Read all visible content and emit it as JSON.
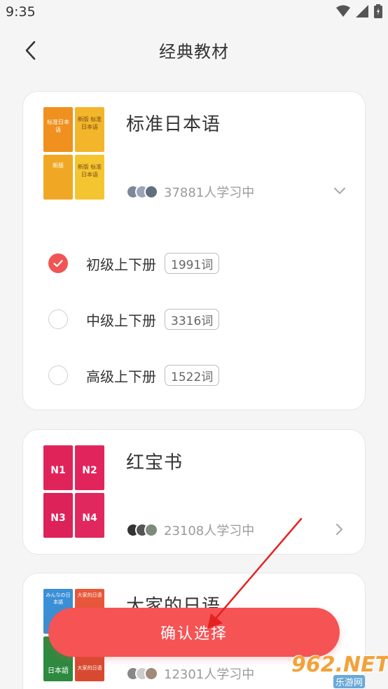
{
  "status_bar": {
    "time": "9:35"
  },
  "header": {
    "title": "经典教材"
  },
  "books": [
    {
      "title": "标准日本语",
      "learners": "37881人学习中",
      "cover_texts": [
        "标准日本语",
        "新版 标准日本语",
        "新版",
        "新版 标准日本语"
      ],
      "levels": [
        {
          "label": "初级上下册",
          "words": "1991词",
          "selected": true
        },
        {
          "label": "中级上下册",
          "words": "3316词",
          "selected": false
        },
        {
          "label": "高级上下册",
          "words": "1522词",
          "selected": false
        }
      ]
    },
    {
      "title": "红宝书",
      "learners": "23108人学习中",
      "cover_texts": [
        "N1",
        "N2",
        "N3",
        "N4"
      ]
    },
    {
      "title": "大家的日语",
      "learners": "12301人学习中",
      "cover_texts": [
        "みんなの日本語",
        "大家的日语",
        "日本語",
        "大家的日语"
      ]
    }
  ],
  "confirm_button": {
    "label": "确认选择"
  },
  "watermark": {
    "main": "962.NET",
    "sub": "乐游网"
  },
  "colors": {
    "accent": "#f55354",
    "check": "#f05454",
    "muted": "#9a9a9a"
  },
  "icons": [
    "wifi-icon",
    "signal-icon",
    "battery-icon",
    "back-arrow-icon",
    "chevron-down-icon",
    "chevron-right-icon",
    "check-icon"
  ]
}
